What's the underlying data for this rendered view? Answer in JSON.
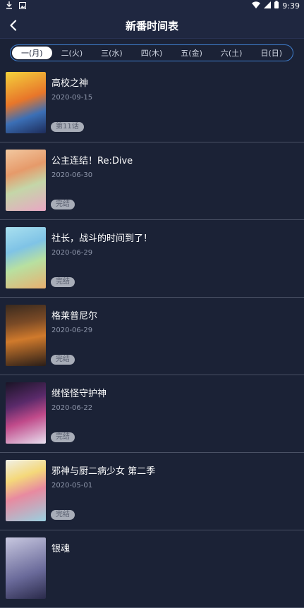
{
  "status": {
    "time": "9:39"
  },
  "appbar": {
    "title": "新番时间表"
  },
  "tabs": [
    "一(月)",
    "二(火)",
    "三(水)",
    "四(木)",
    "五(金)",
    "六(土)",
    "日(日)"
  ],
  "active_tab": 0,
  "items": [
    {
      "title": "高校之神",
      "date": "2020-09-15",
      "badge": "第11话"
    },
    {
      "title": "公主连结！Re:Dive",
      "date": "2020-06-30",
      "badge": "完结"
    },
    {
      "title": "社长，战斗的时间到了！",
      "date": "2020-06-29",
      "badge": "完结"
    },
    {
      "title": "格莱普尼尔",
      "date": "2020-06-29",
      "badge": "完结"
    },
    {
      "title": "继怪怪守护神",
      "date": "2020-06-22",
      "badge": "完结"
    },
    {
      "title": "邪神与厨二病少女 第二季",
      "date": "2020-05-01",
      "badge": "完结"
    },
    {
      "title": "银魂",
      "date": "",
      "badge": ""
    }
  ]
}
